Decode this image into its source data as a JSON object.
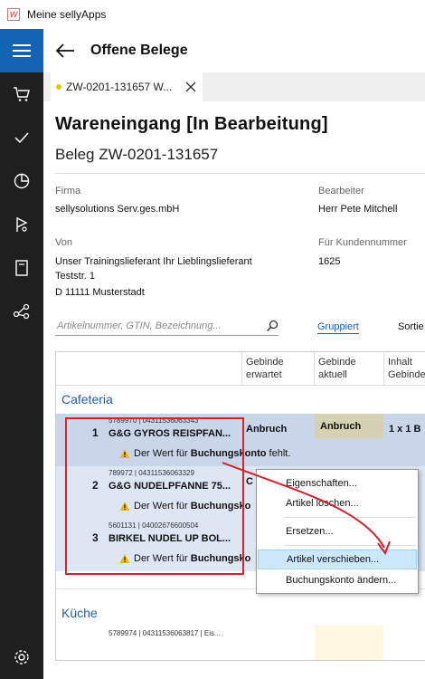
{
  "window": {
    "title": "Meine sellyApps"
  },
  "nav": {
    "items": [
      {
        "name": "menu-icon",
        "active": true
      },
      {
        "name": "cart-icon",
        "active": false
      },
      {
        "name": "check-icon",
        "active": false
      },
      {
        "name": "pie-chart-icon",
        "active": false
      },
      {
        "name": "route-icon",
        "active": false
      },
      {
        "name": "book-icon",
        "active": false
      },
      {
        "name": "share-icon",
        "active": false
      }
    ],
    "settings_icon": "gear-icon"
  },
  "header": {
    "title": "Offene Belege"
  },
  "tab": {
    "label": "ZW-0201-131657 W..."
  },
  "doc": {
    "heading": "Wareneingang [In Bearbeitung]",
    "subheading": "Beleg ZW-0201-131657",
    "firma_label": "Firma",
    "firma_value": "sellysolutions Serv.ges.mbH",
    "bearbeiter_label": "Bearbeiter",
    "bearbeiter_value": "Herr Pete Mitchell",
    "von_label": "Von",
    "von_line1": "Unser Trainingslieferant Ihr Lieblingslieferant",
    "von_line2": "Teststr. 1",
    "von_line3": "D 11111 Musterstadt",
    "kunden_label": "Für Kundennummer",
    "kunden_value": "1625"
  },
  "toolbar": {
    "search_placeholder": "Artikelnummer, GTIN, Bezeichnung...",
    "grouped_label": "Gruppiert",
    "sort_label": "Sortie"
  },
  "grid": {
    "columns": [
      {
        "line1": "Gebinde",
        "line2": "erwartet"
      },
      {
        "line1": "Gebinde",
        "line2": "aktuell"
      },
      {
        "line1": "Inhalt",
        "line2": "Gebinde"
      }
    ],
    "groups": [
      {
        "title": "Cafeteria",
        "rows": [
          {
            "num": "1",
            "code": "5789970 | 04311536063343",
            "name": "G&G GYROS REISPFAN...",
            "warn_prefix": "Der Wert für ",
            "warn_bold": "Buchungskonto",
            "warn_suffix": " fehlt.",
            "erwartet": "Anbruch",
            "aktuell": "Anbruch",
            "inhalt": "1 x 1 B"
          },
          {
            "num": "2",
            "code": "789972 | 04311536063329",
            "name": "G&G NUDELPFANNE 75...",
            "warn_prefix": "Der Wert für ",
            "warn_bold": "Buchungsko",
            "warn_suffix": "",
            "erwartet": "C",
            "aktuell": "",
            "inhalt": ""
          },
          {
            "num": "3",
            "code": "5601131 | 04002676600504",
            "name": "BIRKEL NUDEL UP BOL...",
            "warn_prefix": "Der Wert für ",
            "warn_bold": "Buchungsko",
            "warn_suffix": "",
            "erwartet": "",
            "aktuell": "",
            "inhalt": "G"
          }
        ]
      },
      {
        "title": "Küche",
        "rows": [
          {
            "code": "5789974 | 04311536063817 | Eis..."
          }
        ]
      }
    ]
  },
  "context_menu": {
    "items": [
      "Eigenschaften...",
      "Artikel löschen...",
      "Ersetzen...",
      "Artikel verschieben...",
      "Buchungskonto ändern..."
    ],
    "highlighted": "Artikel verschieben..."
  },
  "colors": {
    "accent": "#1464b4",
    "annotation": "#d9202a",
    "row_bg": "#dde6f3"
  }
}
